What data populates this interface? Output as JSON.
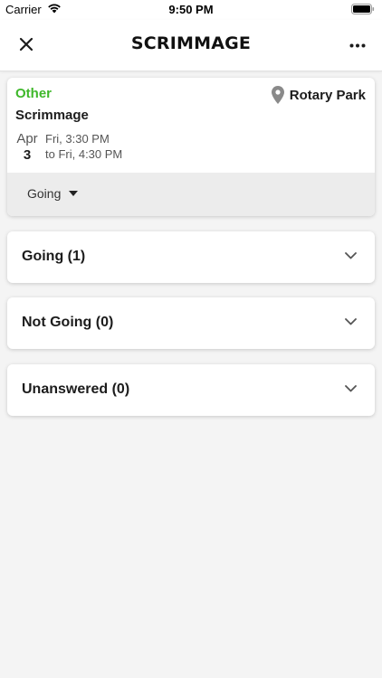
{
  "status_bar": {
    "carrier": "Carrier",
    "time": "9:50 PM"
  },
  "nav": {
    "title": "SCRIMMAGE",
    "close_icon": "close-icon",
    "more_icon": "more-horizontal-icon"
  },
  "event": {
    "type": "Other",
    "type_color": "#3fb82b",
    "location": "Rotary Park",
    "name": "Scrimmage",
    "month": "Apr",
    "day": "3",
    "start": "Fri, 3:30 PM",
    "end": "to Fri, 4:30 PM",
    "rsvp": "Going"
  },
  "sections": [
    {
      "label": "Going (1)"
    },
    {
      "label": "Not Going (0)"
    },
    {
      "label": "Unanswered (0)"
    }
  ]
}
